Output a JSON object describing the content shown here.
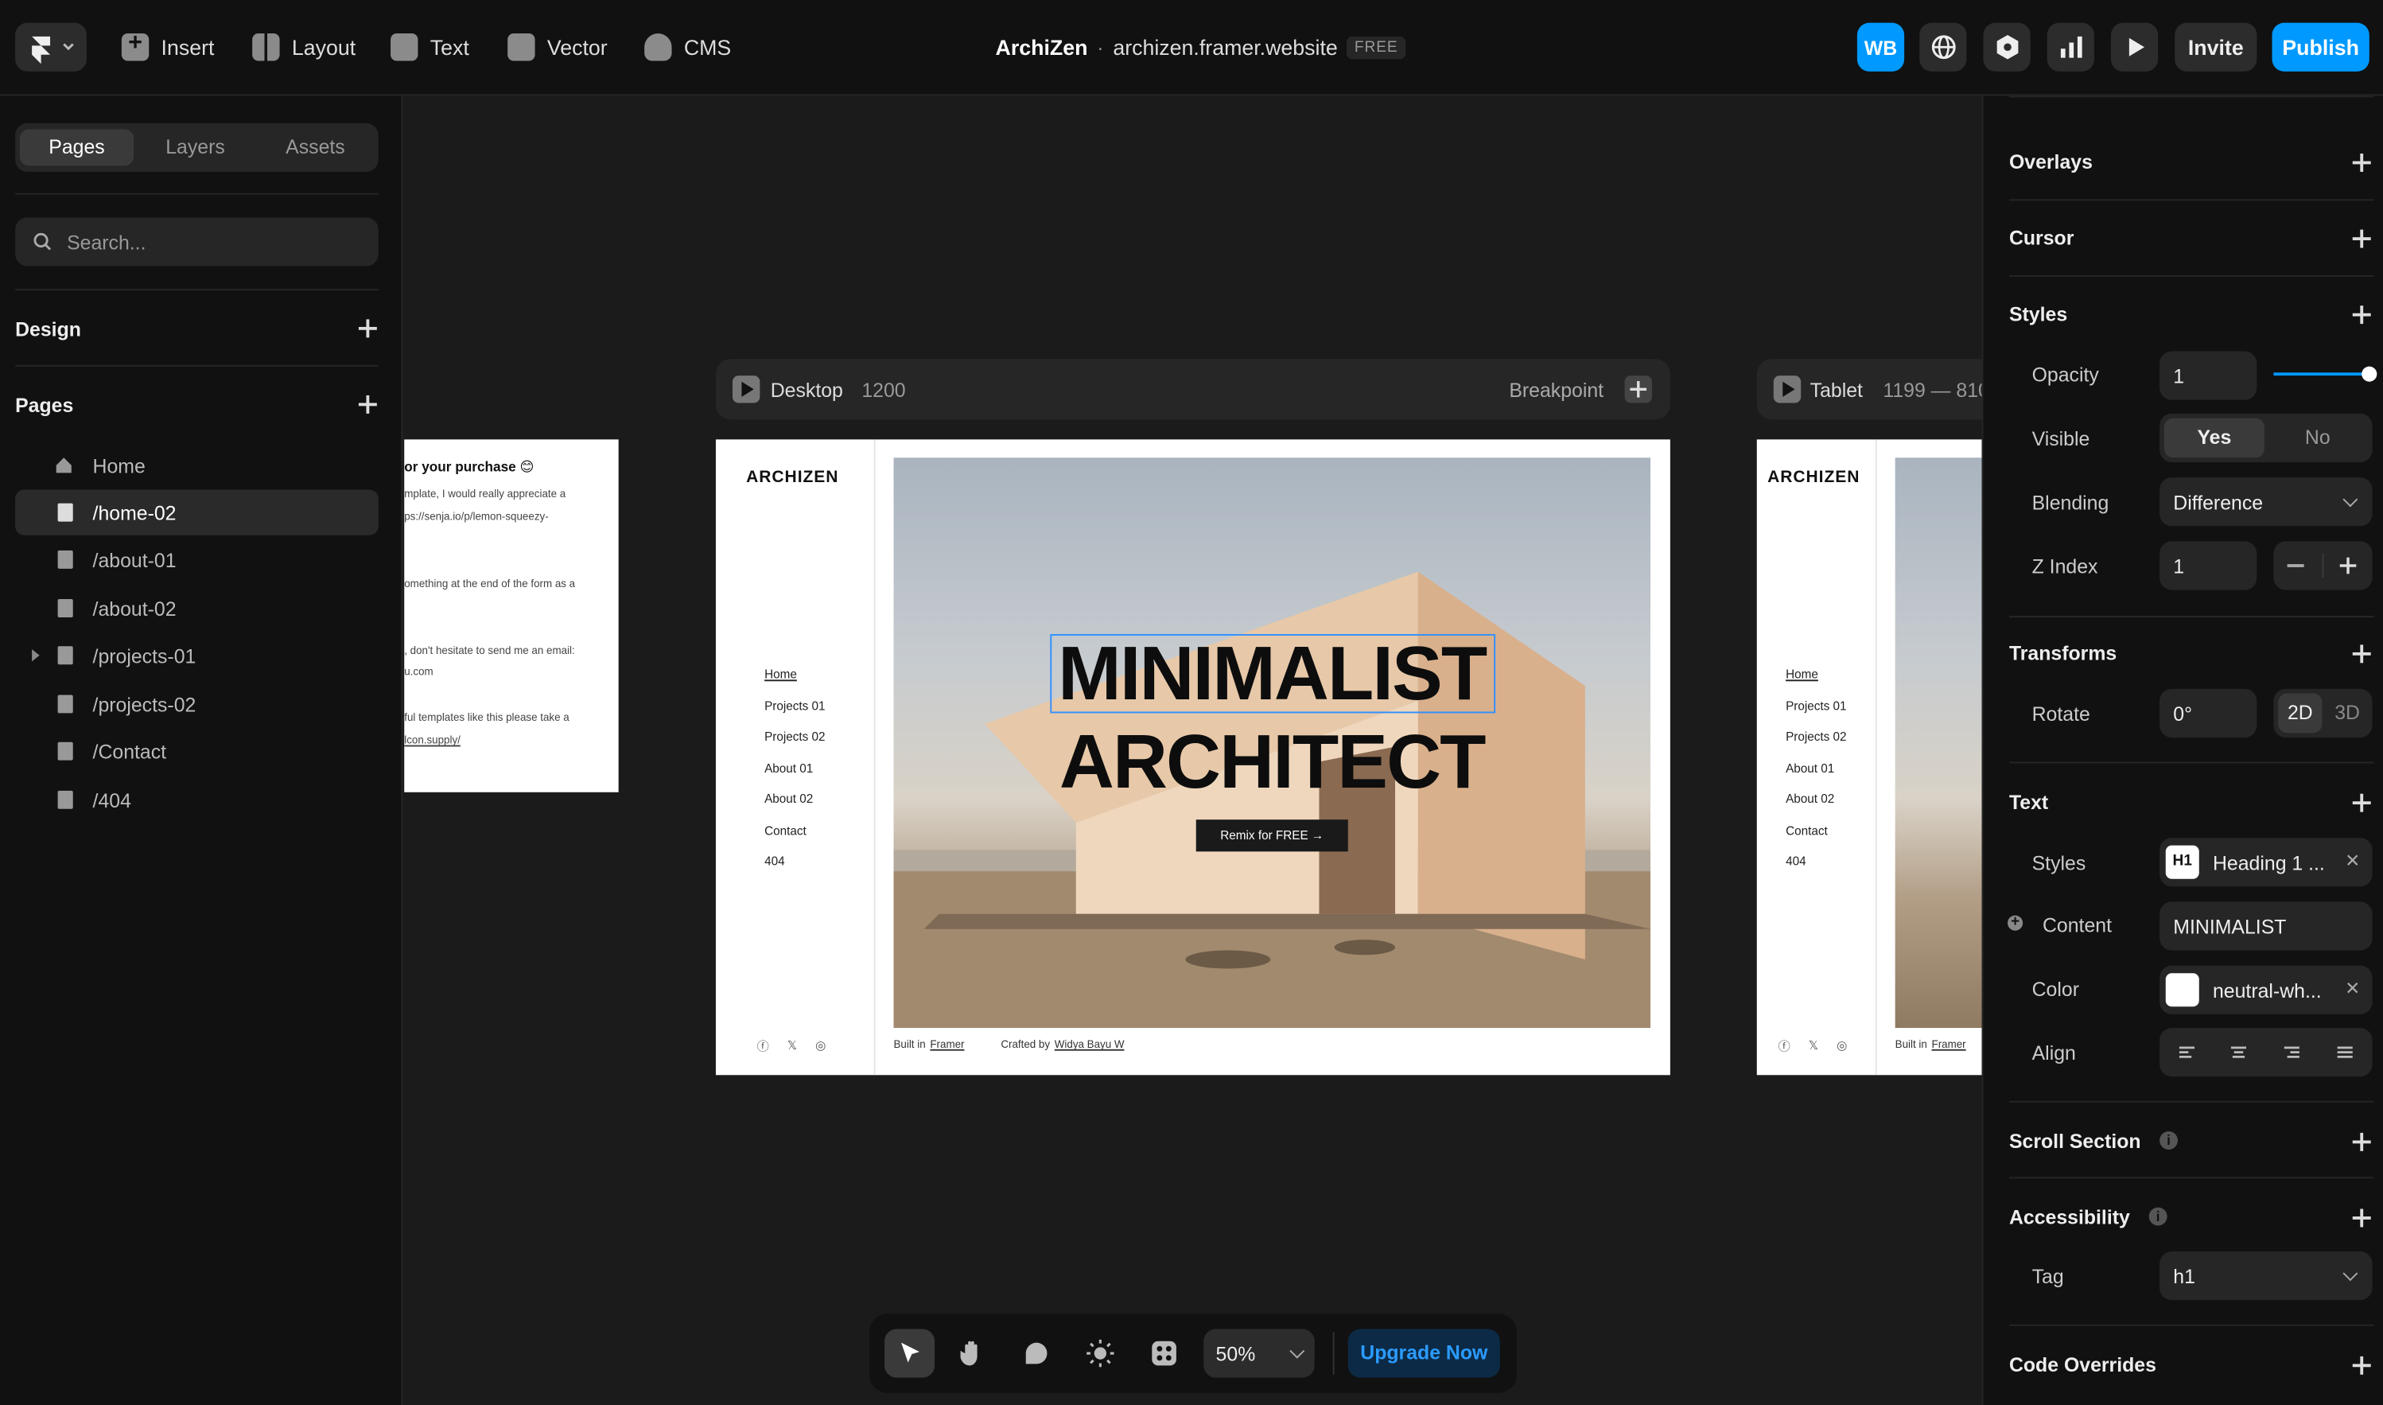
{
  "topbar": {
    "tools": [
      "Insert",
      "Layout",
      "Text",
      "Vector",
      "CMS"
    ],
    "project": "ArchiZen",
    "separator": "·",
    "domain": "archizen.framer.website",
    "plan_badge": "FREE",
    "avatar": "WB",
    "invite": "Invite",
    "publish": "Publish"
  },
  "left": {
    "tabs": [
      "Pages",
      "Layers",
      "Assets"
    ],
    "search_placeholder": "Search...",
    "design_title": "Design",
    "pages_title": "Pages",
    "pages": [
      "Home",
      "/home-02",
      "/about-01",
      "/about-02",
      "/projects-01",
      "/projects-02",
      "/Contact",
      "/404"
    ]
  },
  "canvas": {
    "desktop": {
      "label": "Desktop",
      "width": "1200",
      "breakpoint": "Breakpoint"
    },
    "tablet": {
      "label": "Tablet",
      "range": "1199 — 810"
    },
    "site": {
      "logo": "ARCHIZEN",
      "nav": [
        "Home",
        "Projects 01",
        "Projects 02",
        "About 01",
        "About 02",
        "Contact",
        "404"
      ],
      "hero_line1": "MINIMALIST",
      "hero_line2": "ARCHITECT",
      "cta": "Remix for FREE →",
      "footer_built": "Built in",
      "footer_framer": "Framer",
      "footer_crafted": "Crafted by",
      "footer_author": "Widya Bayu W",
      "social": [
        "ⓕ",
        "𝕏",
        "◎"
      ]
    },
    "left_page_texts": [
      "or your purchase 😊",
      "mplate, I would really appreciate a",
      "ps://senja.io/p/lemon-squeezy-",
      "omething at the end of the form as a",
      ", don't hesitate to send me an email:",
      "u.com",
      "ful templates like this please take a",
      "lcon.supply/"
    ],
    "tablet_site": {
      "logo": "ARCHIZEN",
      "footer_built": "Built in",
      "footer_framer": "Framer"
    }
  },
  "right": {
    "overlays": "Overlays",
    "cursor": "Cursor",
    "styles": "Styles",
    "opacity_label": "Opacity",
    "opacity_value": "1",
    "opacity_fraction": 1.0,
    "visible_label": "Visible",
    "visible_yes": "Yes",
    "visible_no": "No",
    "blending_label": "Blending",
    "blending_value": "Difference",
    "zindex_label": "Z Index",
    "zindex_value": "1",
    "transforms": "Transforms",
    "rotate_label": "Rotate",
    "rotate_value": "0°",
    "mode_2d": "2D",
    "mode_3d": "3D",
    "text": "Text",
    "text_styles_label": "Styles",
    "text_style_badge": "H1",
    "text_style_value": "Heading 1 ...",
    "content_label": "Content",
    "content_value": "MINIMALIST",
    "color_label": "Color",
    "color_value": "neutral-wh...",
    "align_label": "Align",
    "scroll_section": "Scroll Section",
    "accessibility": "Accessibility",
    "tag_label": "Tag",
    "tag_value": "h1",
    "code_overrides": "Code Overrides"
  },
  "bottombar": {
    "zoom": "50%",
    "upgrade": "Upgrade Now"
  },
  "colors": {
    "accent": "#0099ff",
    "panel": "#111111",
    "canvas": "#1b1b1b",
    "selection": "#2f8fff"
  }
}
